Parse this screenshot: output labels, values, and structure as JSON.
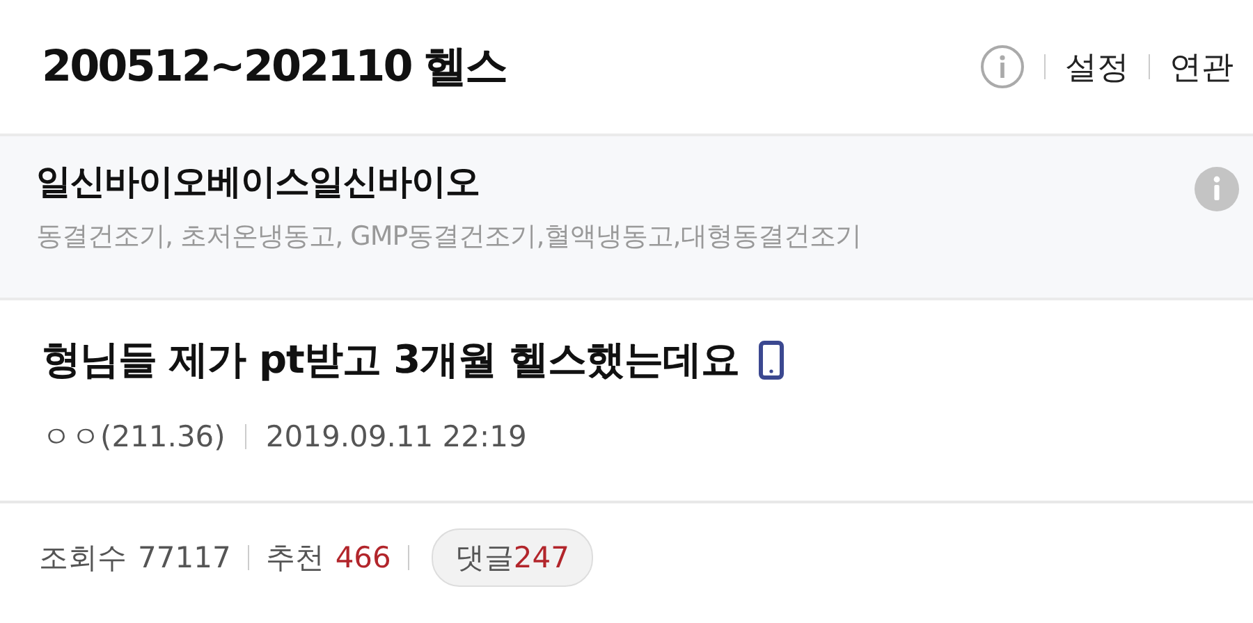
{
  "header": {
    "title": "200512~202110 헬스",
    "links": [
      "설정",
      "연관"
    ]
  },
  "ad": {
    "title": "일신바이오베이스일신바이오",
    "description": "동결건조기, 초저온냉동고, GMP동결건조기,혈액냉동고,대형동결건조기"
  },
  "post": {
    "title": "형님들 제가 pt받고 3개월 헬스했는데요",
    "author": "ㅇㅇ(211.36)",
    "date": "2019.09.11 22:19"
  },
  "stats": {
    "views_label": "조회수",
    "views": "77117",
    "recommend_label": "추천",
    "recommend": "466",
    "comments_label": "댓글",
    "comments": "247"
  }
}
